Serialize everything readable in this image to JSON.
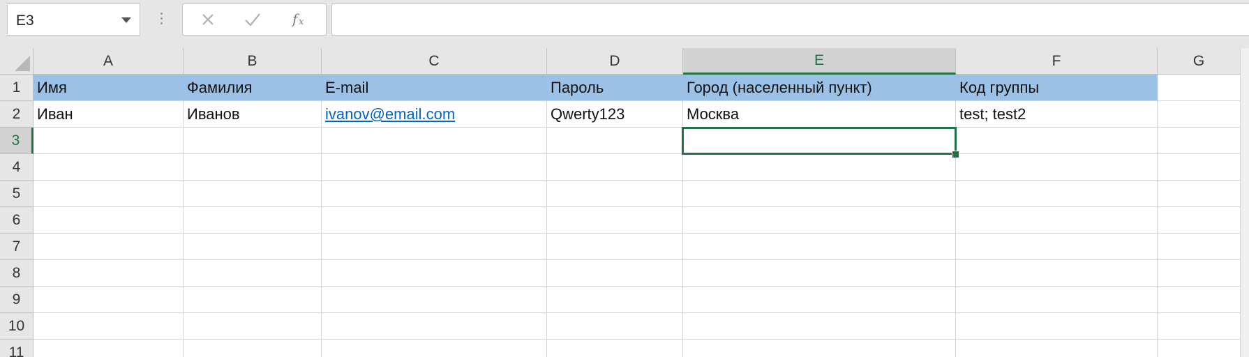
{
  "formula_bar": {
    "name_box_value": "E3",
    "formula_value": "",
    "icons": [
      "close-icon",
      "check-icon",
      "function-icon"
    ]
  },
  "columns": [
    "A",
    "B",
    "C",
    "D",
    "E",
    "F",
    "G"
  ],
  "rows": [
    "1",
    "2",
    "3",
    "4",
    "5",
    "6",
    "7",
    "8",
    "9",
    "10",
    "11"
  ],
  "selected": {
    "column": "E",
    "row": "3"
  },
  "cells": {
    "row1": [
      "Имя",
      "Фамилия",
      "E-mail",
      "Пароль",
      "Город (населенный пункт)",
      "Код группы"
    ],
    "row2": [
      "Иван",
      "Иванов",
      "ivanov@email.com",
      "Qwerty123",
      "Москва",
      "test; test2"
    ]
  },
  "colors": {
    "header_fill": "#9bc2e6",
    "accent": "#217346",
    "link": "#0563c1"
  }
}
